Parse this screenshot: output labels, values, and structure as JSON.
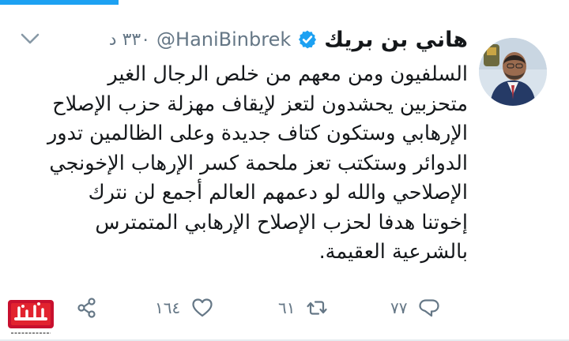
{
  "tweet": {
    "display_name": "هاني بن بريك",
    "handle": "@HaniBinbrek",
    "time": "٣٣٠ د",
    "lines": [
      "السلفيون ومن معهم من خلص الرجال الغير",
      "متحزبين يحشدون لتعز لإيقاف مهزلة حزب الإصلاح",
      "الإرهابي وستكون كتاف جديدة وعلى الظالمين تدور",
      "الدوائر وستكتب تعز ملحمة كسر الإرهاب الإخونجي",
      "الإصلاحي والله لو دعمهم العالم أجمع لن نترك",
      "إخوتنا هدفا لحزب الإصلاح الإرهابي المتمترس",
      "بالشرعية العقيمة."
    ]
  },
  "actions": {
    "replies": "٧٧",
    "retweets": "٦١",
    "likes": "١٦٤"
  },
  "icons": {
    "verified": "verified-badge-icon",
    "caret": "chevron-down-icon",
    "reply": "reply-icon",
    "retweet": "retweet-icon",
    "like": "heart-icon",
    "share": "share-icon"
  },
  "colors": {
    "accent": "#1da1f2",
    "secondary_text": "#657786",
    "primary_text": "#14171a"
  },
  "watermark": {
    "brand": "هنا عدن",
    "url": "hunaaden.com"
  }
}
